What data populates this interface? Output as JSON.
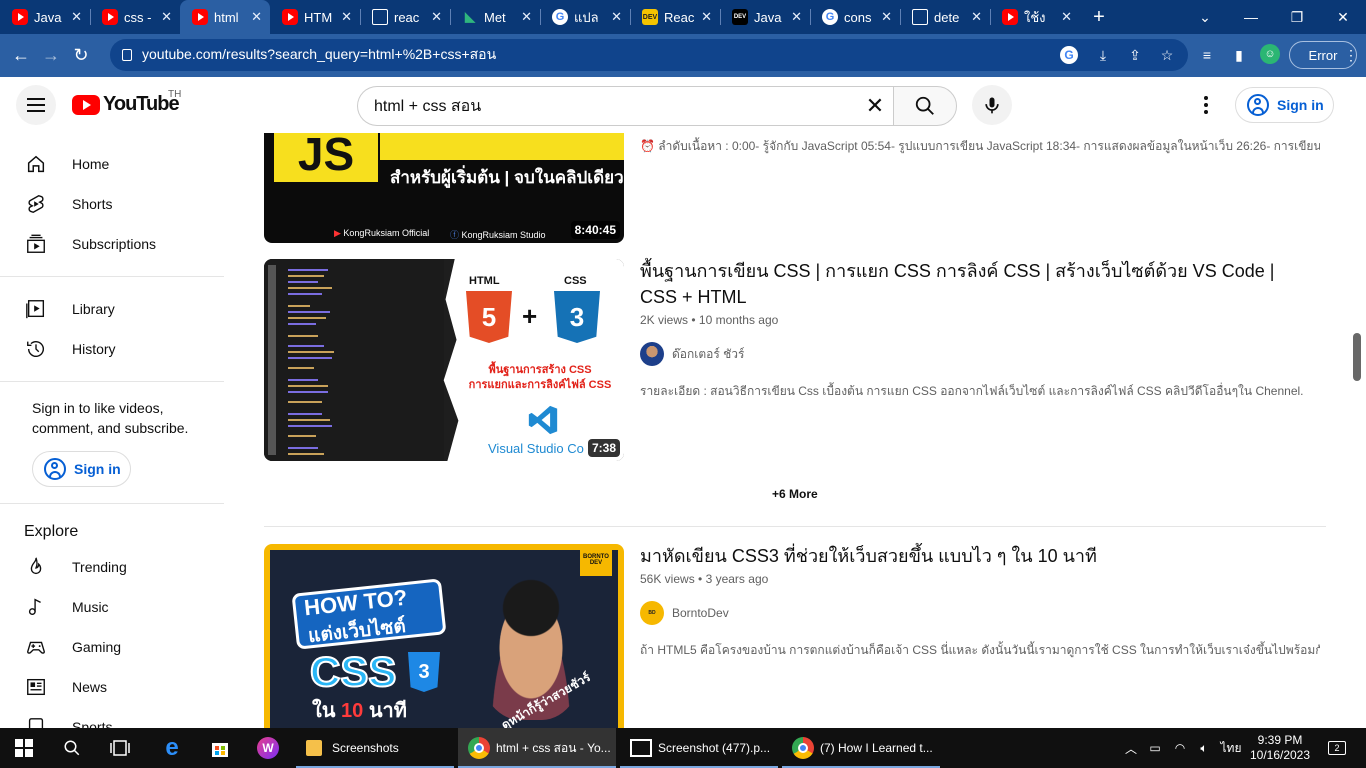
{
  "browser": {
    "tabs": [
      {
        "title": "Java",
        "favicon": "youtube-icon"
      },
      {
        "title": "css -",
        "favicon": "youtube-icon"
      },
      {
        "title": "html",
        "favicon": "youtube-icon",
        "active": true
      },
      {
        "title": "HTM",
        "favicon": "youtube-icon"
      },
      {
        "title": "reac",
        "favicon": "page-icon"
      },
      {
        "title": "Met",
        "favicon": "meta-icon"
      },
      {
        "title": "แปล",
        "favicon": "google-icon"
      },
      {
        "title": "Reac",
        "favicon": "dev-icon"
      },
      {
        "title": "Java",
        "favicon": "dev-icon"
      },
      {
        "title": "cons",
        "favicon": "google-icon"
      },
      {
        "title": "dete",
        "favicon": "page-icon"
      },
      {
        "title": "ใช้ง",
        "favicon": "youtube-icon"
      }
    ],
    "url": "youtube.com/results?search_query=html+%2B+css+สอน",
    "error_label": "Error"
  },
  "youtube": {
    "logo_text": "YouTube",
    "country_code": "TH",
    "search_value": "html + css สอน",
    "signin_label": "Sign in"
  },
  "sidebar": {
    "items": [
      {
        "label": "Home",
        "icon": "home-icon"
      },
      {
        "label": "Shorts",
        "icon": "shorts-icon"
      },
      {
        "label": "Subscriptions",
        "icon": "subscriptions-icon"
      },
      {
        "label": "Library",
        "icon": "library-icon"
      },
      {
        "label": "History",
        "icon": "history-icon"
      }
    ],
    "signin_prompt": "Sign in to like videos, comment, and subscribe.",
    "signin_label": "Sign in",
    "explore_heading": "Explore",
    "explore_items": [
      {
        "label": "Trending",
        "icon": "trending-icon"
      },
      {
        "label": "Music",
        "icon": "music-icon"
      },
      {
        "label": "Gaming",
        "icon": "gaming-icon"
      },
      {
        "label": "News",
        "icon": "news-icon"
      },
      {
        "label": "Sports",
        "icon": "sports-icon"
      }
    ]
  },
  "results": {
    "video1": {
      "thumb_text": "สำหรับผู้เริ่มต้น | จบในคลิปเดียว",
      "thumb_js": "JS",
      "thumb_footer1": "KongRuksiam Official",
      "thumb_footer2": "KongRuksiam Studio",
      "duration": "8:40:45",
      "description": "⏰ ลำดับเนื้อหา : 0:00- รู้จักกับ JavaScript 05:54- รูปแบบการเขียน JavaScript 18:34- การแสดงผลข้อมูลในหน้าเว็บ 26:26- การเขียน ..."
    },
    "video2": {
      "title": "พื้นฐานการเขียน CSS | การแยก CSS การลิงค์ CSS | สร้างเว็บไซต์ด้วย VS Code | CSS + HTML",
      "views": "2K views",
      "age": "10 months ago",
      "channel": "ด๊อกเตอร์ ชัวร์",
      "description": "รายละเอียด : สอนวิธีการเขียน Css เบื้องต้น การแยก CSS ออกจากไฟล์เว็บไซต์ และการลิงค์ไฟล์ CSS คลิปวีดีโออื่นๆใน Chennel.",
      "duration": "7:38",
      "thumb_html": "HTML",
      "thumb_css": "CSS",
      "thumb_caption1": "พื้นฐานการสร้าง CSS",
      "thumb_caption2": "การแยกและการลิงค์ไฟล์ CSS",
      "thumb_vscode": "Visual Studio Co"
    },
    "more_label": "+6 More",
    "video3": {
      "title": "มาหัดเขียน CSS3 ที่ช่วยให้เว็บสวยขึ้น แบบไว ๆ ใน 10 นาที",
      "views": "56K views",
      "age": "3 years ago",
      "channel": "BorntoDev",
      "description": "ถ้า HTML5 คือโครงของบ้าน การตกแต่งบ้านก็คือเจ้า CSS นี่แหละ ดังนั้นวันนี้เรามาดูการใช้ CSS ในการทำให้เว็บเราเจ๋งขึ้นไปพร้อมกัน !",
      "thumb_howto": "HOW TO?",
      "thumb_line2": "แต่งเว็บไซต์",
      "thumb_css": "CSS",
      "thumb_in": "ใน",
      "thumb_10": "10",
      "thumb_min": "นาที",
      "thumb_side": "ดูหน้าก็รู้ว่าสวยชัวร์",
      "thumb_badge": "BORNTO DEV"
    }
  },
  "taskbar": {
    "apps": [
      {
        "label": "Screenshots"
      },
      {
        "label": "html + css สอน - Yo..."
      },
      {
        "label": "Screenshot (477).p..."
      },
      {
        "label": "(7) How I Learned t..."
      }
    ],
    "lang": "ไทย",
    "time": "9:39 PM",
    "date": "10/16/2023",
    "notif_count": "2"
  }
}
